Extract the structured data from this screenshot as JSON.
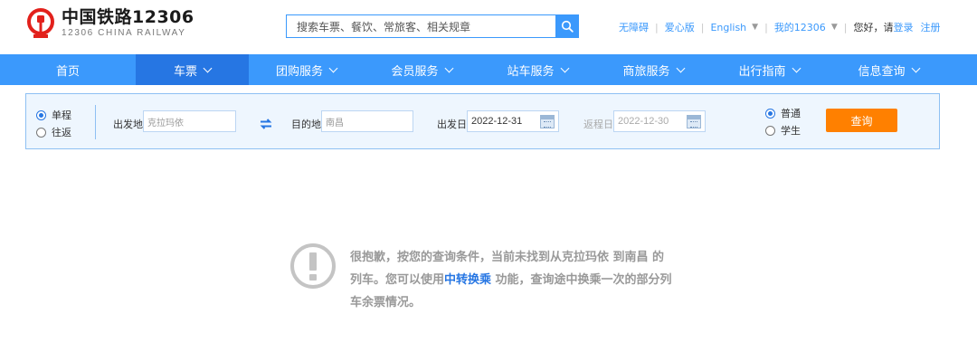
{
  "header": {
    "logo_cn": "中国铁路12306",
    "logo_en": "12306 CHINA RAILWAY",
    "search_placeholder": "搜索车票、餐饮、常旅客、相关规章",
    "links": {
      "accessible": "无障碍",
      "care": "爱心版",
      "english": "English",
      "my12306": "我的12306",
      "greeting": "您好，请",
      "login": "登录",
      "register": "注册"
    }
  },
  "nav": {
    "items": [
      {
        "label": "首页",
        "dropdown": false
      },
      {
        "label": "车票",
        "dropdown": true,
        "active": true
      },
      {
        "label": "团购服务",
        "dropdown": true
      },
      {
        "label": "会员服务",
        "dropdown": true
      },
      {
        "label": "站车服务",
        "dropdown": true
      },
      {
        "label": "商旅服务",
        "dropdown": true
      },
      {
        "label": "出行指南",
        "dropdown": true
      },
      {
        "label": "信息查询",
        "dropdown": true
      }
    ]
  },
  "query": {
    "trip_one_way": "单程",
    "trip_round": "往返",
    "trip_selected": "单程",
    "from_label": "出发地",
    "from_value": "克拉玛依",
    "to_label": "目的地",
    "to_value": "南昌",
    "depart_label": "出发日",
    "depart_value": "2022-12-31",
    "return_label": "返程日",
    "return_value": "2022-12-30",
    "type_normal": "普通",
    "type_student": "学生",
    "type_selected": "普通",
    "query_button": "查询"
  },
  "empty": {
    "msg_part1": "很抱歉，按您的查询条件，当前未找到从克拉玛依 到南昌 的列车。您可以使用",
    "link": "中转换乘",
    "msg_part2": " 功能，查询途中换乘一次的部分列车余票情况。"
  },
  "colors": {
    "brand_blue": "#3b99fc",
    "nav_active": "#2676e3",
    "query_orange": "#ff8000",
    "logo_red": "#e2211c"
  }
}
